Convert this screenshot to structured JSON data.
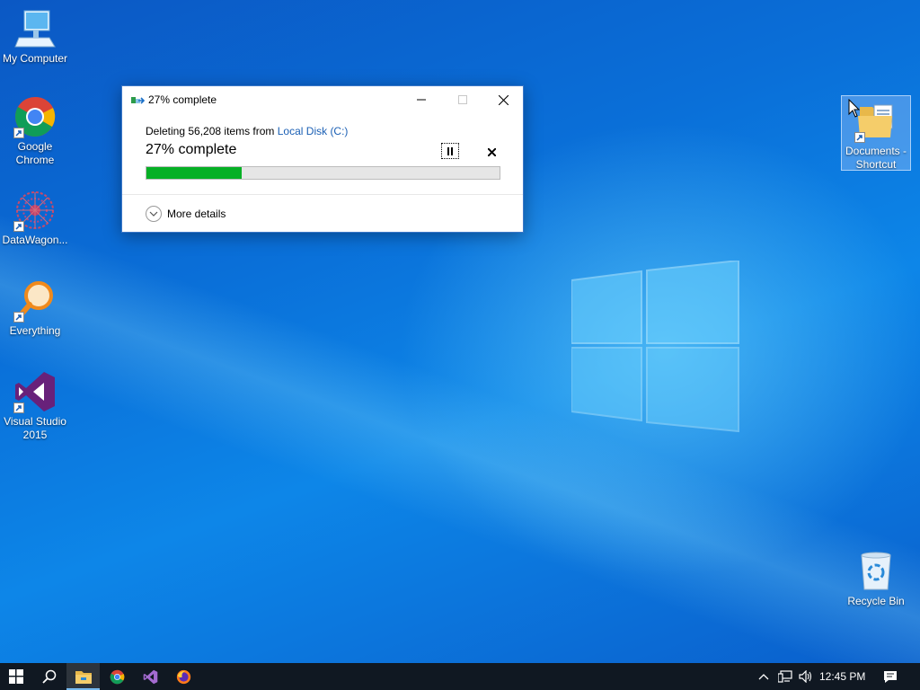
{
  "desktop": {
    "icons": [
      {
        "label": "My Computer",
        "icon": "computer-icon"
      },
      {
        "label": "Google Chrome",
        "icon": "chrome-icon"
      },
      {
        "label": "DataWagon...",
        "icon": "datawagon-icon"
      },
      {
        "label": "Everything",
        "icon": "everything-search-icon"
      },
      {
        "label": "Visual Studio 2015",
        "icon": "visual-studio-icon"
      },
      {
        "label": "Documents - Shortcut",
        "icon": "documents-folder-icon"
      },
      {
        "label": "Recycle Bin",
        "icon": "recycle-bin-icon"
      }
    ]
  },
  "dialog": {
    "title": "27% complete",
    "deleting_prefix": "Deleting 56,208 items from ",
    "location_link": "Local Disk (C:)",
    "percent_text": "27% complete",
    "progress_fraction": 0.27,
    "more_details": "More details",
    "progress_color": "#06b025"
  },
  "taskbar": {
    "items": [
      "start-icon",
      "search-icon",
      "file-explorer-icon",
      "chrome-icon",
      "visual-studio-icon",
      "firefox-icon"
    ],
    "tray": [
      "chevron-up-icon",
      "network-icon",
      "volume-icon",
      "notifications-icon"
    ],
    "clock": "12:45 PM"
  }
}
